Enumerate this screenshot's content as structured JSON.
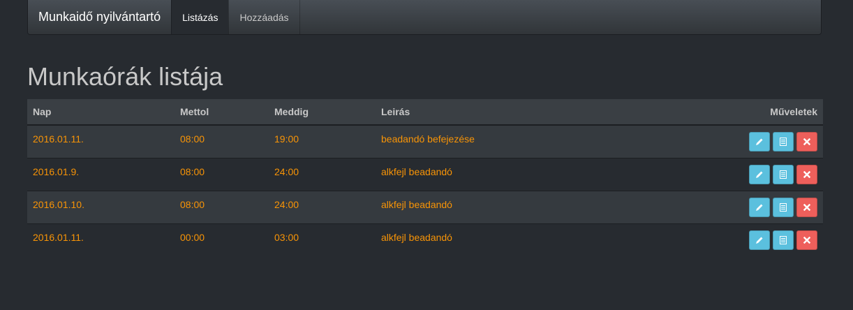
{
  "navbar": {
    "brand": "Munkaidő nyilvántartó",
    "items": [
      {
        "label": "Listázás",
        "active": true
      },
      {
        "label": "Hozzáadás",
        "active": false
      }
    ]
  },
  "page": {
    "title": "Munkaórák listája"
  },
  "table": {
    "headers": {
      "nap": "Nap",
      "mettol": "Mettol",
      "meddig": "Meddig",
      "leiras": "Leirás",
      "muveletek": "Műveletek"
    },
    "rows": [
      {
        "nap": "2016.01.11.",
        "mettol": "08:00",
        "meddig": "19:00",
        "leiras": "beadandó befejezése"
      },
      {
        "nap": "2016.01.9.",
        "mettol": "08:00",
        "meddig": "24:00",
        "leiras": "alkfejl beadandó"
      },
      {
        "nap": "2016.01.10.",
        "mettol": "08:00",
        "meddig": "24:00",
        "leiras": "alkfejl beadandó"
      },
      {
        "nap": "2016.01.11.",
        "mettol": "00:00",
        "meddig": "03:00",
        "leiras": "alkfejl beadandó"
      }
    ],
    "actions": [
      {
        "name": "edit",
        "icon": "pencil-icon",
        "color": "#5bc0de"
      },
      {
        "name": "details",
        "icon": "list-icon",
        "color": "#5bc0de"
      },
      {
        "name": "delete",
        "icon": "remove-icon",
        "color": "#ee5f5b"
      }
    ]
  },
  "colors": {
    "background": "#272b30",
    "navbar": "#3a3f44",
    "row_text": "#f89406",
    "info": "#5bc0de",
    "danger": "#ee5f5b"
  }
}
